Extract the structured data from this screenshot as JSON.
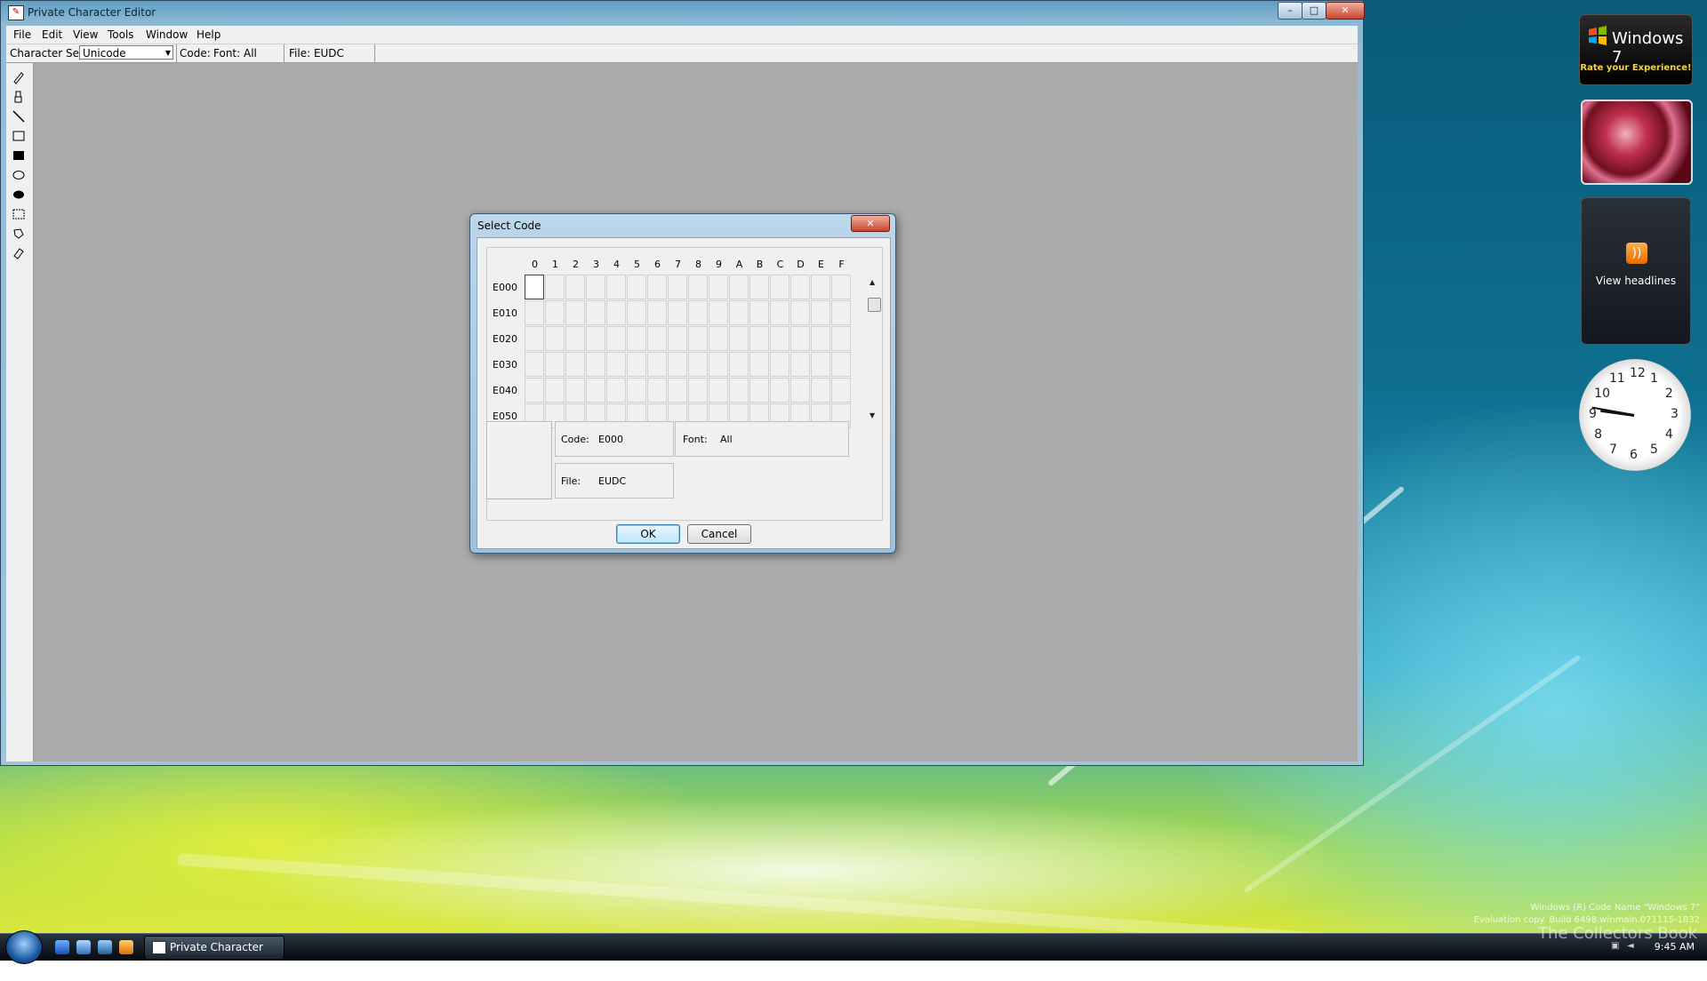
{
  "window": {
    "title": "Private Character Editor",
    "controls": {
      "minimize": "–",
      "maximize": "□",
      "close": "✕"
    }
  },
  "menu": [
    "File",
    "Edit",
    "View",
    "Tools",
    "Window",
    "Help"
  ],
  "toolbar": {
    "charset_label": "Character Set:",
    "charset_value": "Unicode",
    "code_label": "Code:",
    "font_label": "Font: All",
    "file_label": "File: EUDC"
  },
  "tools": [
    "pencil-icon",
    "brush-icon",
    "line-icon",
    "hollow-rectangle-icon",
    "filled-rectangle-icon",
    "hollow-ellipse-icon",
    "filled-ellipse-icon",
    "rectangular-selection-icon",
    "freeform-selection-icon",
    "eraser-icon"
  ],
  "dialog": {
    "title": "Select Code",
    "columns": [
      "0",
      "1",
      "2",
      "3",
      "4",
      "5",
      "6",
      "7",
      "8",
      "9",
      "A",
      "B",
      "C",
      "D",
      "E",
      "F"
    ],
    "rows": [
      "E000",
      "E010",
      "E020",
      "E030",
      "E040",
      "E050"
    ],
    "code_label": "Code:",
    "code_value": "E000",
    "font_label": "Font:",
    "font_value": "All",
    "file_label": "File:",
    "file_value": "EUDC",
    "ok": "OK",
    "cancel": "Cancel"
  },
  "gadgets": {
    "win7_title": "Windows 7",
    "win7_sub": "Rate your Experience!",
    "feed_text": "View headlines",
    "clock_numbers": [
      "12",
      "1",
      "2",
      "3",
      "4",
      "5",
      "6",
      "7",
      "8",
      "9",
      "10",
      "11"
    ]
  },
  "taskbar": {
    "task_label": "Private Character Ed...",
    "time": "9:45 AM"
  },
  "watermark": {
    "line1": "Windows (R) Code Name \"Windows 7\"",
    "line2": "Evaluation copy. Build 6498.winmain.071115-1832",
    "brand": "The Collectors Book"
  },
  "colors": {
    "accent": "#3c7fb1",
    "close_red": "#c84530",
    "client_gray": "#ababab"
  }
}
